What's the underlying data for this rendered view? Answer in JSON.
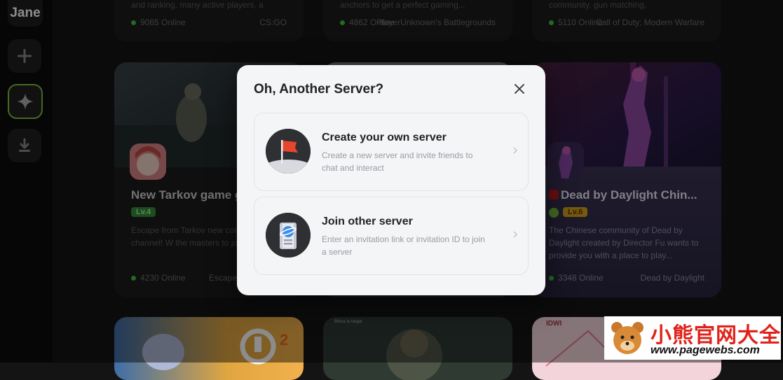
{
  "sidebar": {
    "user_name": "Jane",
    "items": [
      {
        "icon": "plus-icon"
      },
      {
        "icon": "sparkle-icon",
        "active": true
      },
      {
        "icon": "download-icon"
      }
    ]
  },
  "top_cards": [
    {
      "desc": "and ranking, many active players, a",
      "online": "9065 Online",
      "game": "CS:GO"
    },
    {
      "desc": "anchors to get a perfect gaming...",
      "online": "4862 Online",
      "game": "PlayerUnknown's Battlegrounds"
    },
    {
      "desc": "community, gun matching,",
      "online": "5110 Online",
      "game": "Call of Duty: Modern Warfare"
    }
  ],
  "mid_cards": [
    {
      "title": "New Tarkov game g",
      "level": "Lv.4",
      "desc": "Escape from Tarkov new communication channel! W the masters to join the cha",
      "online": "4230 Online",
      "game": "Escape"
    },
    {
      "title": "Dead by Daylight Chin...",
      "level": "Lv.6",
      "desc": "The Chinese community of Dead by Daylight created by Director Fu wants to provide you with a place to play...",
      "online": "3348 Online",
      "game": "Dead by Daylight"
    }
  ],
  "modal": {
    "title": "Oh, Another Server?",
    "options": [
      {
        "title": "Create your own server",
        "desc": "Create a new server and invite friends to chat and interact",
        "icon": "flag-icon"
      },
      {
        "title": "Join other server",
        "desc": "Enter an invitation link or invitation ID to join a server",
        "icon": "planet-door-icon"
      }
    ]
  },
  "bottom_cards": [
    {
      "badge_text": "2"
    },
    {
      "small_text": "Bfirea la Negat"
    },
    {
      "small_text": "IDWI"
    }
  ],
  "watermark": {
    "text": "小熊官网大全",
    "url": "www.pagewebs.com"
  },
  "colors": {
    "online": "#3fbf3f",
    "level_green": "#2f8f3a",
    "level_gold": "#d9a21a",
    "watermark_red": "#e0231a",
    "sidebar_active_border": "#7fbf3f"
  }
}
